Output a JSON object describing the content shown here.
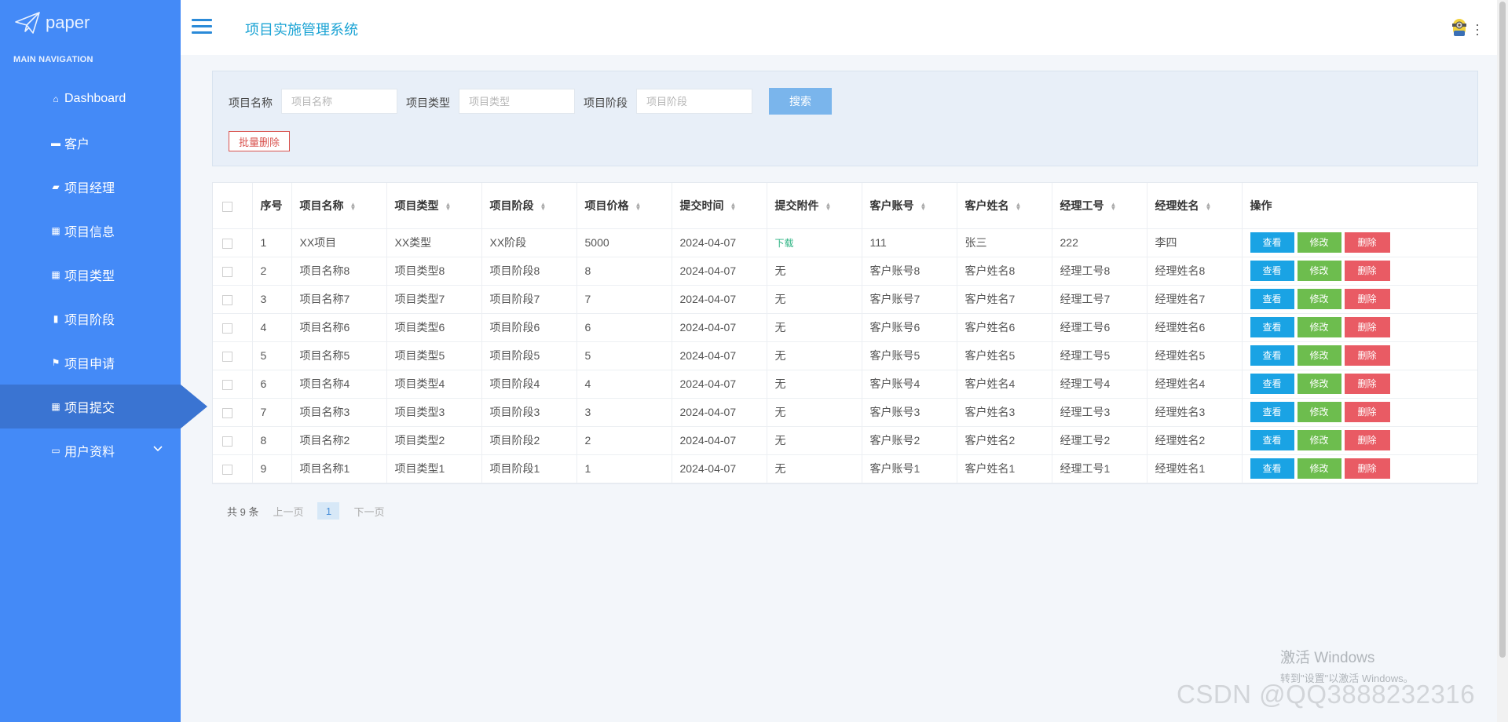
{
  "sidebar": {
    "logo_text": "paper",
    "heading": "MAIN NAVIGATION",
    "items": [
      {
        "label": "Dashboard",
        "icon": "home-icon"
      },
      {
        "label": "客户",
        "icon": "briefcase-icon"
      },
      {
        "label": "项目经理",
        "icon": "comment-icon"
      },
      {
        "label": "项目信息",
        "icon": "grid-icon"
      },
      {
        "label": "项目类型",
        "icon": "table-icon"
      },
      {
        "label": "项目阶段",
        "icon": "bar-chart-icon"
      },
      {
        "label": "项目申请",
        "icon": "flag-icon"
      },
      {
        "label": "项目提交",
        "icon": "grid-icon",
        "active": true
      },
      {
        "label": "用户资料",
        "icon": "calendar-icon",
        "expandable": true
      }
    ]
  },
  "header": {
    "title": "项目实施管理系统"
  },
  "search": {
    "name_label": "项目名称",
    "name_placeholder": "项目名称",
    "type_label": "项目类型",
    "type_placeholder": "项目类型",
    "stage_label": "项目阶段",
    "stage_placeholder": "项目阶段",
    "search_button": "搜索",
    "batch_delete": "批量删除"
  },
  "table": {
    "headers": [
      "序号",
      "项目名称",
      "项目类型",
      "项目阶段",
      "项目价格",
      "提交时间",
      "提交附件",
      "客户账号",
      "客户姓名",
      "经理工号",
      "经理姓名",
      "操作"
    ],
    "rows": [
      [
        "1",
        "XX项目",
        "XX类型",
        "XX阶段",
        "5000",
        "2024-04-07",
        "下载",
        "111",
        "张三",
        "222",
        "李四"
      ],
      [
        "2",
        "项目名称8",
        "项目类型8",
        "项目阶段8",
        "8",
        "2024-04-07",
        "无",
        "客户账号8",
        "客户姓名8",
        "经理工号8",
        "经理姓名8"
      ],
      [
        "3",
        "项目名称7",
        "项目类型7",
        "项目阶段7",
        "7",
        "2024-04-07",
        "无",
        "客户账号7",
        "客户姓名7",
        "经理工号7",
        "经理姓名7"
      ],
      [
        "4",
        "项目名称6",
        "项目类型6",
        "项目阶段6",
        "6",
        "2024-04-07",
        "无",
        "客户账号6",
        "客户姓名6",
        "经理工号6",
        "经理姓名6"
      ],
      [
        "5",
        "项目名称5",
        "项目类型5",
        "项目阶段5",
        "5",
        "2024-04-07",
        "无",
        "客户账号5",
        "客户姓名5",
        "经理工号5",
        "经理姓名5"
      ],
      [
        "6",
        "项目名称4",
        "项目类型4",
        "项目阶段4",
        "4",
        "2024-04-07",
        "无",
        "客户账号4",
        "客户姓名4",
        "经理工号4",
        "经理姓名4"
      ],
      [
        "7",
        "项目名称3",
        "项目类型3",
        "项目阶段3",
        "3",
        "2024-04-07",
        "无",
        "客户账号3",
        "客户姓名3",
        "经理工号3",
        "经理姓名3"
      ],
      [
        "8",
        "项目名称2",
        "项目类型2",
        "项目阶段2",
        "2",
        "2024-04-07",
        "无",
        "客户账号2",
        "客户姓名2",
        "经理工号2",
        "经理姓名2"
      ],
      [
        "9",
        "项目名称1",
        "项目类型1",
        "项目阶段1",
        "1",
        "2024-04-07",
        "无",
        "客户账号1",
        "客户姓名1",
        "经理工号1",
        "经理姓名1"
      ]
    ],
    "actions": {
      "view": "查看",
      "edit": "修改",
      "delete": "删除"
    }
  },
  "pager": {
    "total": "共 9 条",
    "prev": "上一页",
    "current": "1",
    "next": "下一页"
  },
  "watermark": {
    "windows_line1": "激活 Windows",
    "windows_line2": "转到\"设置\"以激活 Windows。",
    "csdn": "CSDN @QQ3888232316"
  },
  "colors": {
    "sidebar": "#448af7",
    "sidebar_active": "#3a74d2",
    "title": "#1aa3d4",
    "view": "#1aa3e4",
    "edit": "#6dbd4e",
    "delete": "#e95b64"
  }
}
